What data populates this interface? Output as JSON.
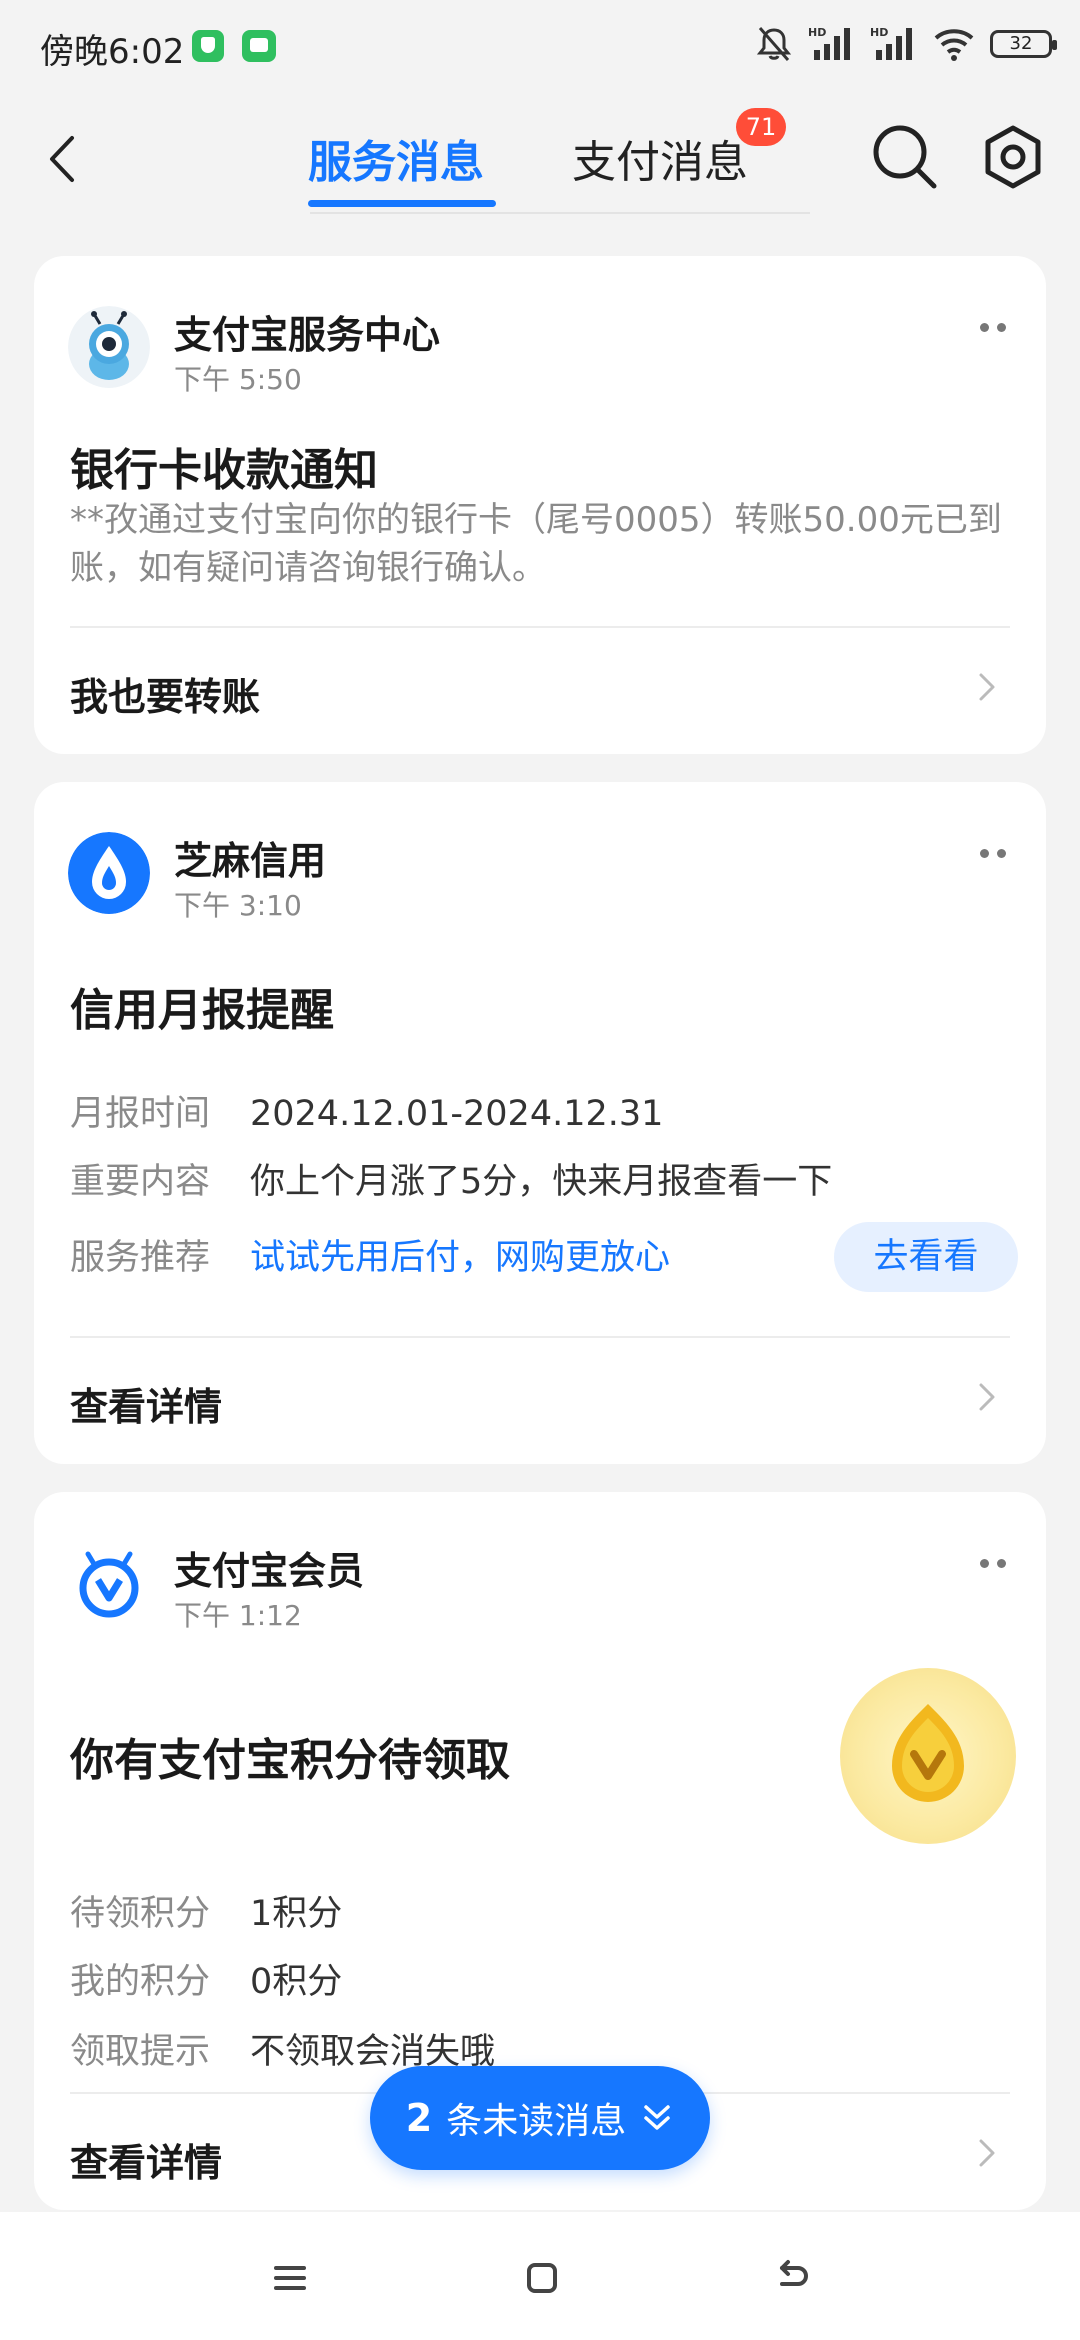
{
  "status_bar": {
    "time": "傍晚6:02",
    "battery": "32"
  },
  "header": {
    "tabs": [
      {
        "label": "服务消息",
        "active": true
      },
      {
        "label": "支付消息",
        "active": false,
        "badge": "71"
      }
    ]
  },
  "cards": [
    {
      "source": "支付宝服务中心",
      "time": "下午 5:50",
      "title": "银行卡收款通知",
      "body": "**孜通过支付宝向你的银行卡（尾号0005）转账50.00元已到账，如有疑问请咨询银行确认。",
      "action": "我也要转账"
    },
    {
      "source": "芝麻信用",
      "time": "下午 3:10",
      "title": "信用月报提醒",
      "rows": [
        {
          "key": "月报时间",
          "value": "2024.12.01-2024.12.31"
        },
        {
          "key": "重要内容",
          "value": "你上个月涨了5分，快来月报查看一下"
        },
        {
          "key": "服务推荐",
          "value": "试试先用后付，网购更放心"
        }
      ],
      "pill": "去看看",
      "action": "查看详情"
    },
    {
      "source": "支付宝会员",
      "time": "下午 1:12",
      "title": "你有支付宝积分待领取",
      "rows": [
        {
          "key": "待领积分",
          "value": "1积分"
        },
        {
          "key": "我的积分",
          "value": "0积分"
        },
        {
          "key": "领取提示",
          "value": "不领取会消失哦"
        }
      ],
      "action": "查看详情"
    }
  ],
  "unread": {
    "count": "2",
    "label": "条未读消息"
  },
  "colors": {
    "accent": "#1677ff",
    "badge": "#ff4d38",
    "background": "#f3f3f3"
  }
}
